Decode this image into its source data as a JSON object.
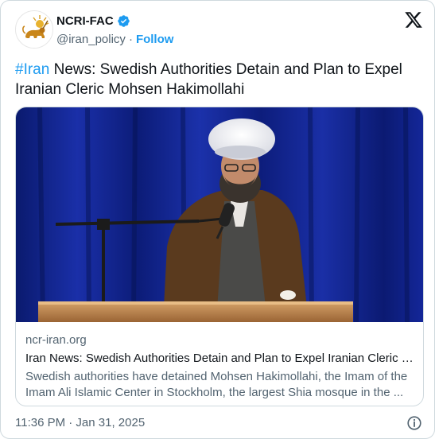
{
  "author": {
    "display_name": "NCRI-FAC",
    "handle": "@iran_policy",
    "separator": "·",
    "follow_label": "Follow",
    "avatar_icon": "lion-and-sun-emblem-icon",
    "verified_icon": "verified-badge-icon"
  },
  "tweet": {
    "hashtag": "#Iran",
    "text": " News: Swedish Authorities Detain and Plan to Expel Iranian Cleric Mohsen Hakimollahi"
  },
  "link_card": {
    "domain": "ncr-iran.org",
    "title": "Iran News: Swedish Authorities Detain and Plan to Expel Iranian Cleric Mohsen Hakimollahi",
    "description": "Swedish authorities have detained Mohsen Hakimollahi, the Imam of the Imam Ali Islamic Center in Stockholm, the largest Shia mosque in the ..."
  },
  "footer": {
    "timestamp": "11:36 PM · Jan 31, 2025",
    "info_icon": "info-icon"
  },
  "colors": {
    "accent": "#1d9bf0",
    "text_primary": "#0f1419",
    "text_secondary": "#536471",
    "border": "#cfd9de"
  }
}
